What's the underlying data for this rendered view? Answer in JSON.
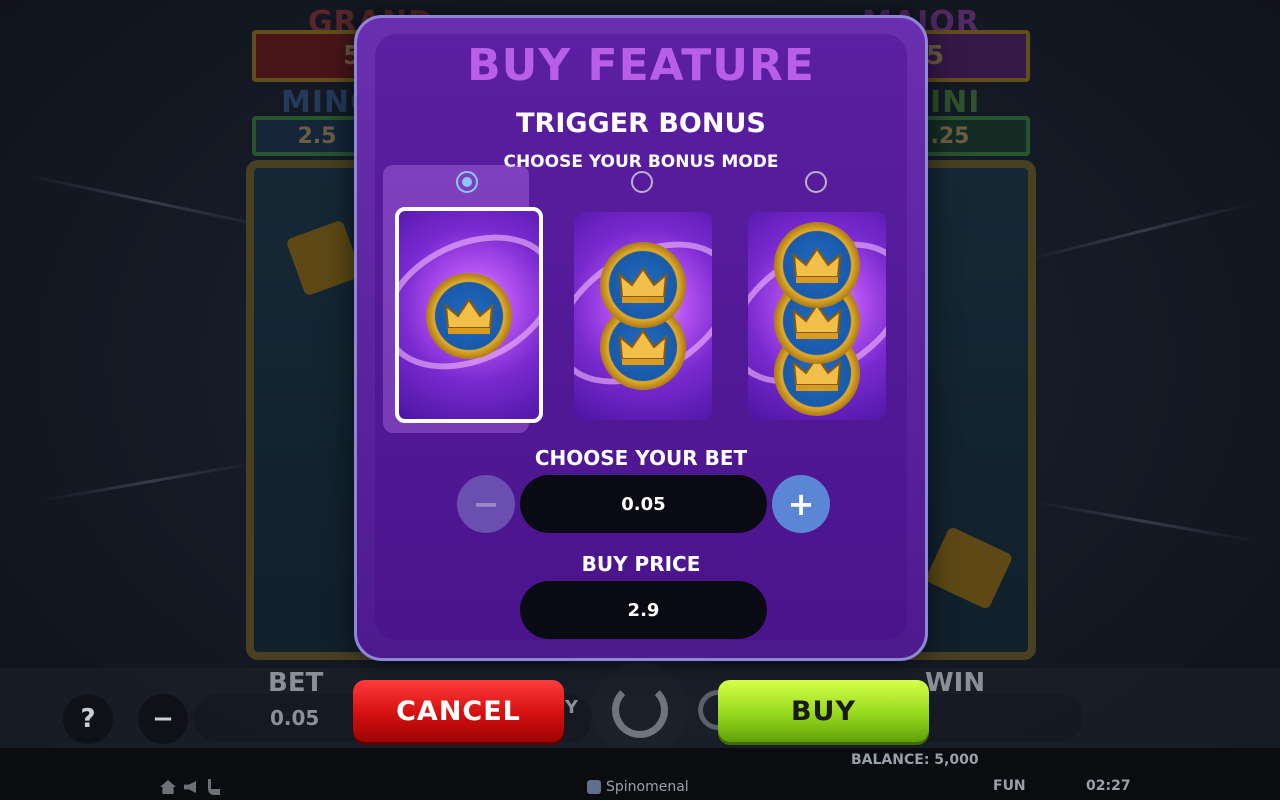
{
  "modal": {
    "title": "BUY FEATURE",
    "subtitle": "TRIGGER BONUS",
    "mode_label": "CHOOSE YOUR BONUS MODE",
    "modes": [
      {
        "coins": 1,
        "selected": true
      },
      {
        "coins": 2,
        "selected": false
      },
      {
        "coins": 3,
        "selected": false
      }
    ],
    "bet_label": "CHOOSE YOUR BET",
    "bet_value": "0.05",
    "minus_symbol": "−",
    "plus_symbol": "+",
    "price_label": "BUY PRICE",
    "price_value": "2.9"
  },
  "actions": {
    "cancel_label": "CANCEL",
    "buy_label": "BUY"
  },
  "background": {
    "jackpots": {
      "grand_label": "GRAND",
      "grand_value": "5",
      "major_label": "MAJOR",
      "major_value": "5",
      "minor_label": "MINO",
      "minor_value": "2.5",
      "mini_label": "INI",
      "mini_value": ".25"
    },
    "bar": {
      "help_symbol": "?",
      "minus_symbol": "−",
      "bet_label": "BET",
      "bet_value": "0.05",
      "win_label": "WIN",
      "partial_label": "Y"
    },
    "status": {
      "balance": "BALANCE: 5,000",
      "brand": "Spinomenal",
      "mode": "FUN",
      "time": "02:27"
    }
  },
  "colors": {
    "title": "#b95ee6",
    "cancel": "#d40f0f",
    "buy": "#95d91d",
    "plus_button": "#5b86d6"
  }
}
